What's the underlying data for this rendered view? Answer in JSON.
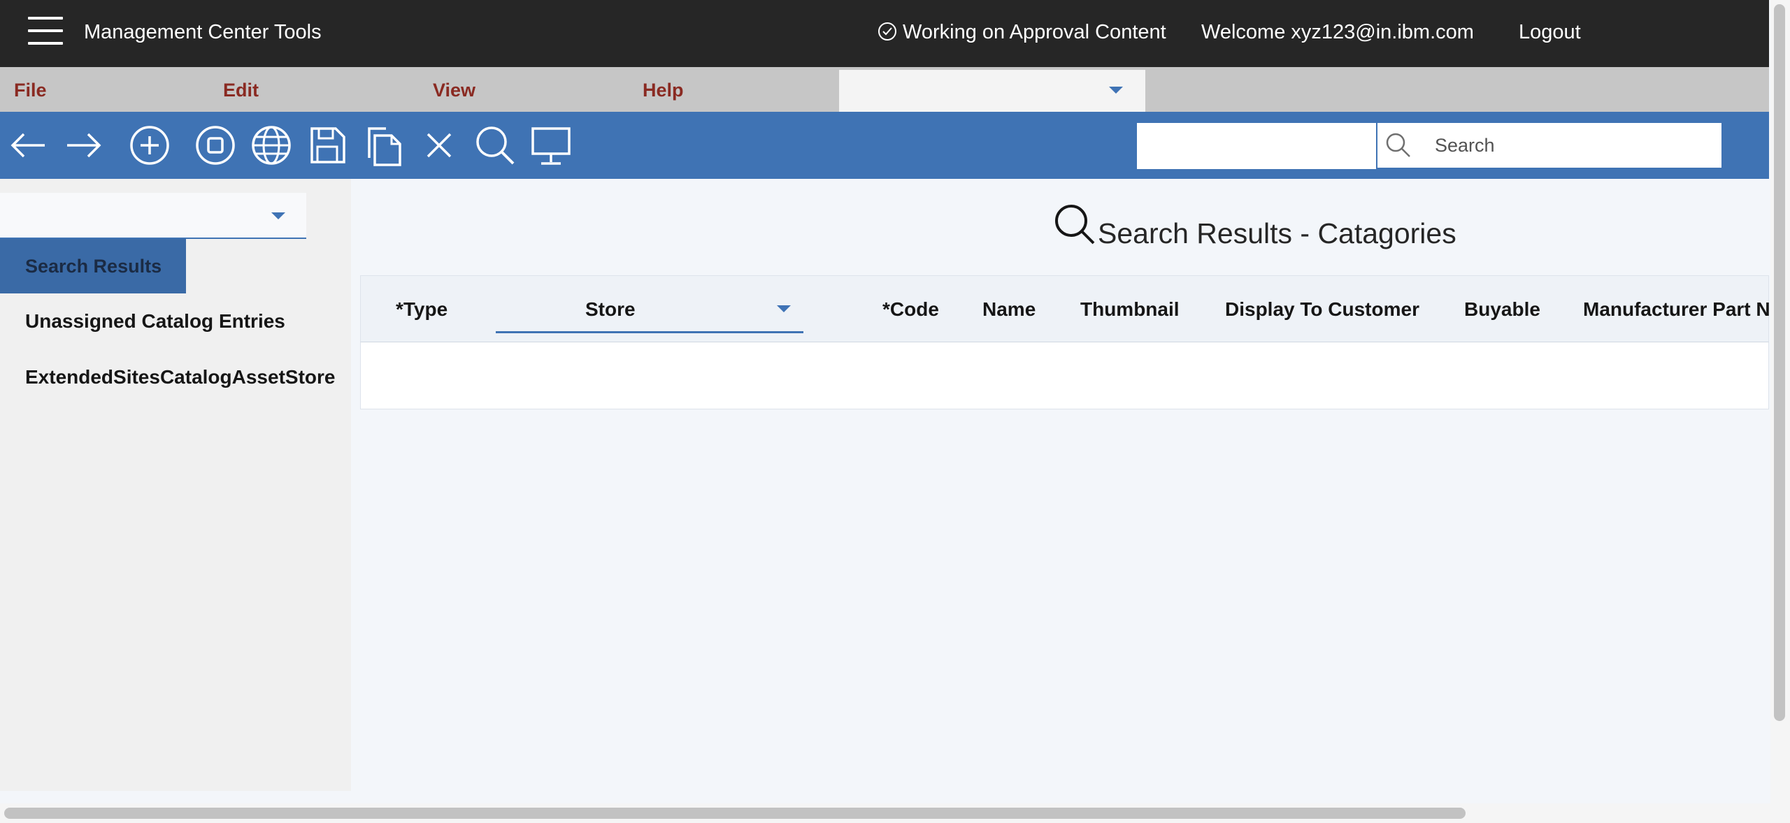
{
  "header": {
    "app_title": "Management Center Tools",
    "status_text": "Working on Approval Content",
    "welcome_text": "Welcome xyz123@in.ibm.com",
    "logout_label": "Logout"
  },
  "menubar": {
    "items": [
      {
        "label": "File"
      },
      {
        "label": "Edit"
      },
      {
        "label": "View"
      },
      {
        "label": "Help"
      }
    ],
    "dropdown_value": ""
  },
  "toolbar": {
    "icons": [
      "back-icon",
      "forward-icon",
      "add-icon",
      "stop-icon",
      "globe-icon",
      "save-icon",
      "copy-icon",
      "close-icon",
      "search-icon",
      "preview-monitor-icon"
    ],
    "input_value": "",
    "search_placeholder": "Search"
  },
  "sidebar": {
    "select_value": "",
    "active_tab": "Search Results",
    "items": [
      {
        "label": "Unassigned Catalog Entries"
      },
      {
        "label": "ExtendedSitesCatalogAssetStore"
      }
    ]
  },
  "main": {
    "title": "Search Results - Catagories",
    "columns": [
      "*Type",
      "Store",
      "*Code",
      "Name",
      "Thumbnail",
      "Display To Customer",
      "Buyable",
      "Manufacturer Part Nu"
    ],
    "rows": []
  },
  "colors": {
    "header_bg": "#262626",
    "menubar_bg": "#c6c6c6",
    "menu_text": "#8a2a22",
    "toolbar_bg": "#3f73b4",
    "active_tab_bg": "#3a6aa6"
  }
}
